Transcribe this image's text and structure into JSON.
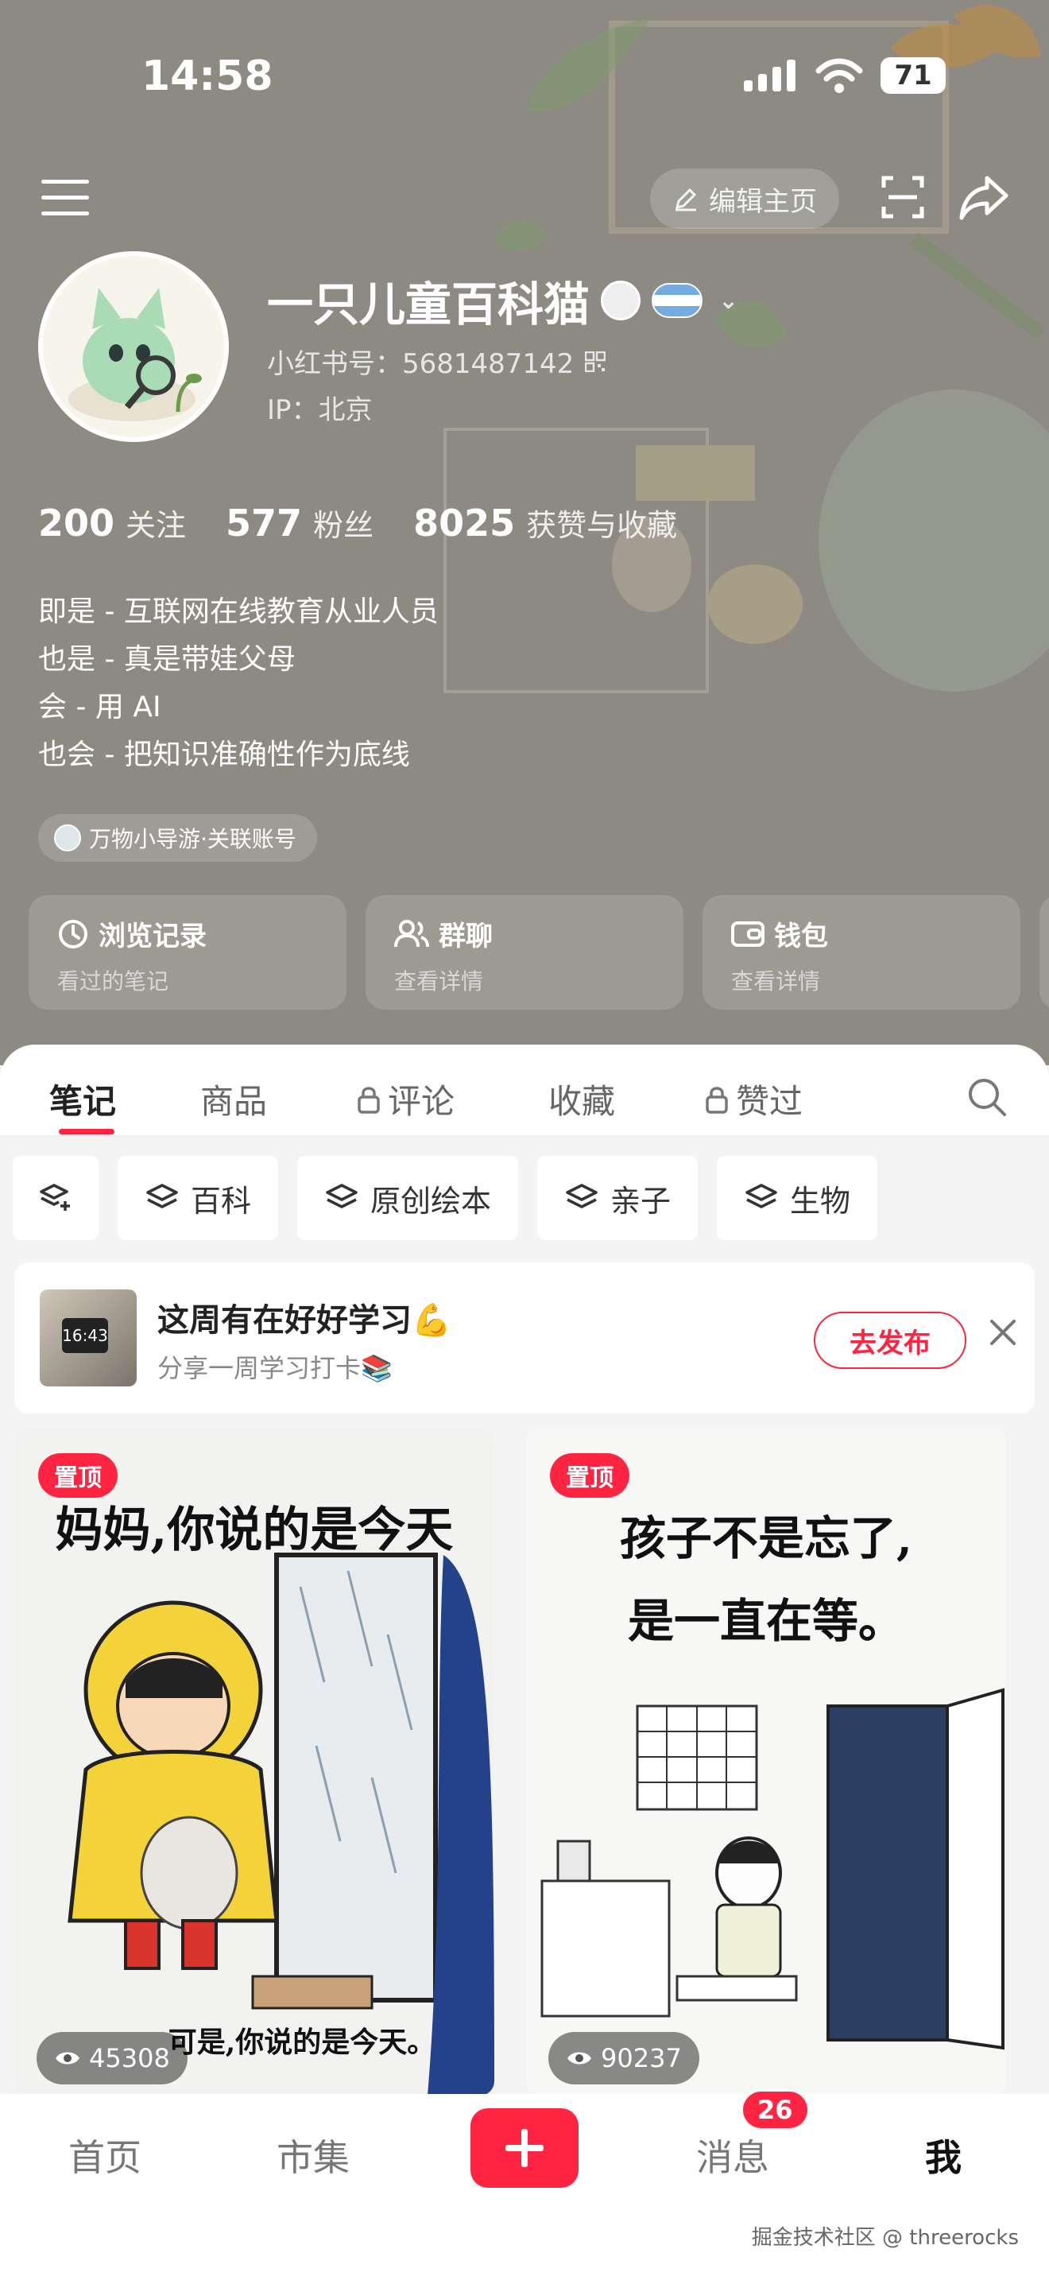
{
  "status": {
    "time": "14:58",
    "battery": "71"
  },
  "header": {
    "edit_home": "编辑主页"
  },
  "profile": {
    "name": "一只儿童百科猫",
    "redbook_id": "小红书号：5681487142",
    "ip": "IP：北京"
  },
  "stats": [
    {
      "num": "200",
      "label": "关注"
    },
    {
      "num": "577",
      "label": "粉丝"
    },
    {
      "num": "8025",
      "label": "获赞与收藏"
    }
  ],
  "bio": [
    "即是 - 互联网在线教育从业人员",
    "也是 - 真是带娃父母",
    "会 - 用 AI",
    "也会 - 把知识准确性作为底线"
  ],
  "linked_account": "万物小导游·关联账号",
  "shortcuts": [
    {
      "title": "浏览记录",
      "sub": "看过的笔记",
      "icon": "clock-icon"
    },
    {
      "title": "群聊",
      "sub": "查看详情",
      "icon": "group-icon"
    },
    {
      "title": "钱包",
      "sub": "查看详情",
      "icon": "wallet-icon"
    }
  ],
  "tabs": [
    {
      "label": "笔记",
      "active": true,
      "locked": false
    },
    {
      "label": "商品",
      "active": false,
      "locked": false
    },
    {
      "label": "评论",
      "active": false,
      "locked": true
    },
    {
      "label": "收藏",
      "active": false,
      "locked": false
    },
    {
      "label": "赞过",
      "active": false,
      "locked": true
    }
  ],
  "chips": [
    "百科",
    "原创绘本",
    "亲子",
    "生物"
  ],
  "promo": {
    "thumb_time": "16:43",
    "title": "这周有在好好学习💪",
    "sub": "分享一周学习打卡📚",
    "button": "去发布"
  },
  "posts": [
    {
      "pin": "置顶",
      "headline": "妈妈,你说的是今天",
      "caption": "可是,你说的是今天。",
      "views": "45308"
    },
    {
      "pin": "置顶",
      "headline_line1": "孩子不是忘了,",
      "headline_line2": "是一直在等。",
      "views": "90237"
    }
  ],
  "bottom_nav": {
    "home": "首页",
    "market": "市集",
    "messages": "消息",
    "messages_badge": "26",
    "me": "我"
  },
  "watermark": "掘金技术社区 @ threerocks",
  "colors": {
    "accent": "#ff2442",
    "hero_bg": "#8c8a84"
  }
}
